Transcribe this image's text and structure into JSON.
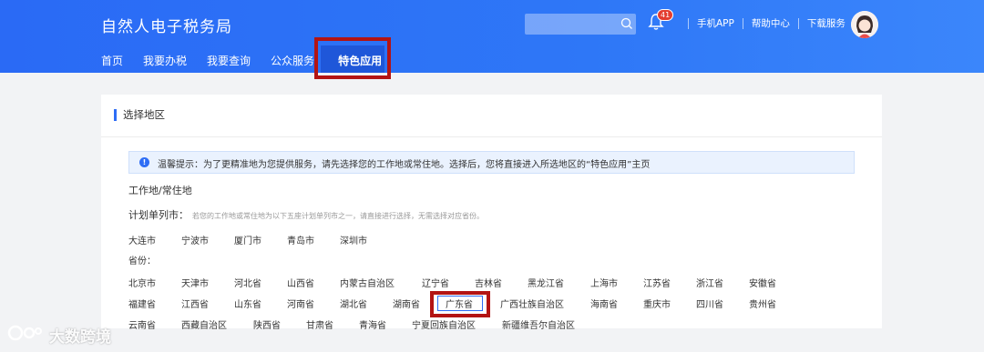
{
  "header": {
    "brand": "自然人电子税务局",
    "nav": [
      "首页",
      "我要办税",
      "我要查询",
      "公众服务",
      "特色应用"
    ],
    "search_placeholder": "",
    "notification_count": "41",
    "links": [
      "手机APP",
      "帮助中心",
      "下载服务"
    ]
  },
  "panel": {
    "title": "选择地区",
    "tip": "温馨提示：为了更精准地为您提供服务，请先选择您的工作地或常住地。选择后，您将直接进入所选地区的“特色应用”主页",
    "work_label": "工作地/常住地",
    "plan_label": "计划单列市：",
    "plan_note": "若您的工作地或常住地为以下五座计划单列市之一，请直接进行选择，无需选择对应省份。",
    "cities": [
      "大连市",
      "宁波市",
      "厦门市",
      "青岛市",
      "深圳市"
    ],
    "province_label": "省份：",
    "provinces_row1": [
      "北京市",
      "天津市",
      "河北省",
      "山西省",
      "内蒙古自治区",
      "辽宁省",
      "吉林省",
      "黑龙江省",
      "上海市",
      "江苏省",
      "浙江省",
      "安徽省"
    ],
    "provinces_row2": [
      "福建省",
      "江西省",
      "山东省",
      "河南省",
      "湖北省",
      "湖南省",
      "广东省",
      "广西壮族自治区",
      "海南省",
      "重庆市",
      "四川省",
      "贵州省"
    ],
    "provinces_row3": [
      "云南省",
      "西藏自治区",
      "陕西省",
      "甘肃省",
      "青海省",
      "宁夏回族自治区",
      "新疆维吾尔自治区"
    ]
  },
  "watermark": "大数跨境",
  "colors": {
    "header_blue": "#2e77f7",
    "highlight_red": "#b31414",
    "accent": "#2e6df5"
  }
}
